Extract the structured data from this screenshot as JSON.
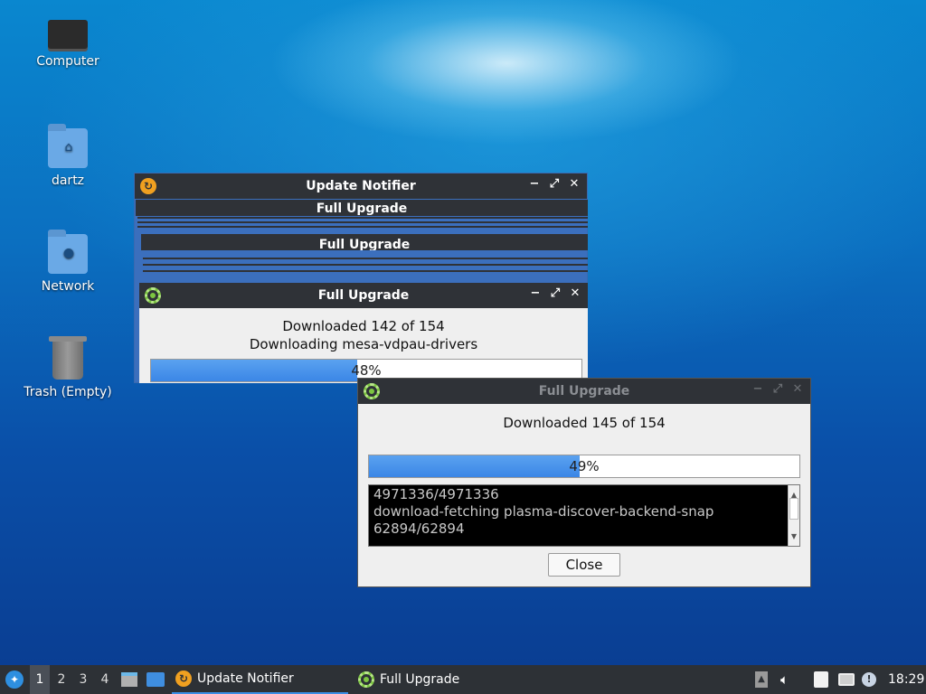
{
  "desktop": {
    "icons": [
      {
        "label": "Computer",
        "icon": "computer-icon"
      },
      {
        "label": "dartz",
        "icon": "home-folder-icon"
      },
      {
        "label": "Network",
        "icon": "network-folder-icon"
      },
      {
        "label": "Trash (Empty)",
        "icon": "trash-icon"
      }
    ]
  },
  "update_notifier": {
    "title": "Update Notifier",
    "icon": "update-notifier-icon",
    "controls": [
      "−",
      "⤢",
      "✕"
    ]
  },
  "stacked_windows": {
    "title_1": "Full Upgrade",
    "title_2": "Full Upgrade"
  },
  "upgrade_window_back": {
    "title": "Full Upgrade",
    "line1": "Downloaded 142 of 154",
    "line2": "Downloading mesa-vdpau-drivers",
    "progress_label": "48%",
    "progress_value": 48
  },
  "upgrade_window_front": {
    "title": "Full Upgrade",
    "status": "Downloaded 145 of 154",
    "progress_label": "49%",
    "progress_value": 49,
    "log_lines": [
      "4971336/4971336",
      "download-fetching plasma-discover-backend-snap",
      "62894/62894"
    ],
    "close_button": "Close"
  },
  "taskbar": {
    "desktops": [
      "1",
      "2",
      "3",
      "4"
    ],
    "active_desktop": "1",
    "tasks": [
      {
        "label": "Update Notifier",
        "icon": "update-notifier-icon",
        "active": true
      },
      {
        "label": "Full Upgrade",
        "icon": "gear-icon",
        "active": false
      }
    ],
    "clock": "18:29"
  }
}
